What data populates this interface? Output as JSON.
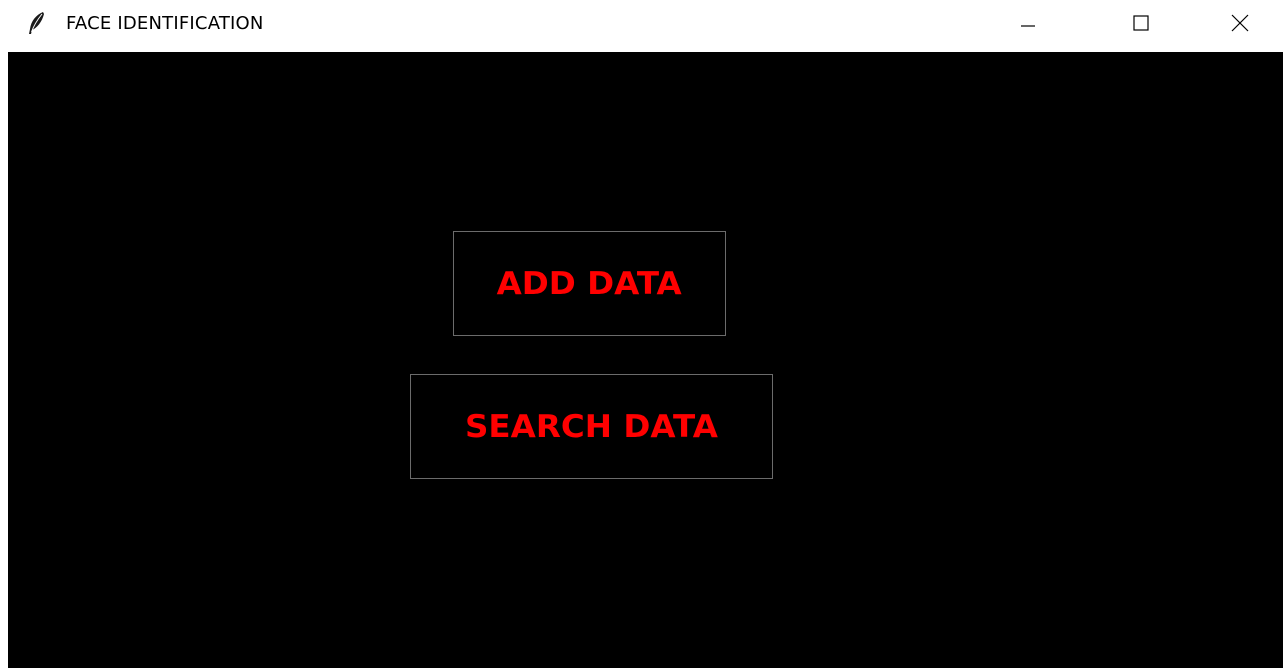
{
  "window": {
    "title": "FACE IDENTIFICATION",
    "app_icon": "feather-icon",
    "controls": {
      "minimize_icon": "minimize-icon",
      "maximize_icon": "maximize-icon",
      "close_icon": "close-icon"
    }
  },
  "main": {
    "background_color": "#000000",
    "button_text_color": "#ff0000",
    "button_border_color": "#6b6b6b",
    "buttons": {
      "add_label": "ADD DATA",
      "search_label": "SEARCH DATA"
    }
  }
}
